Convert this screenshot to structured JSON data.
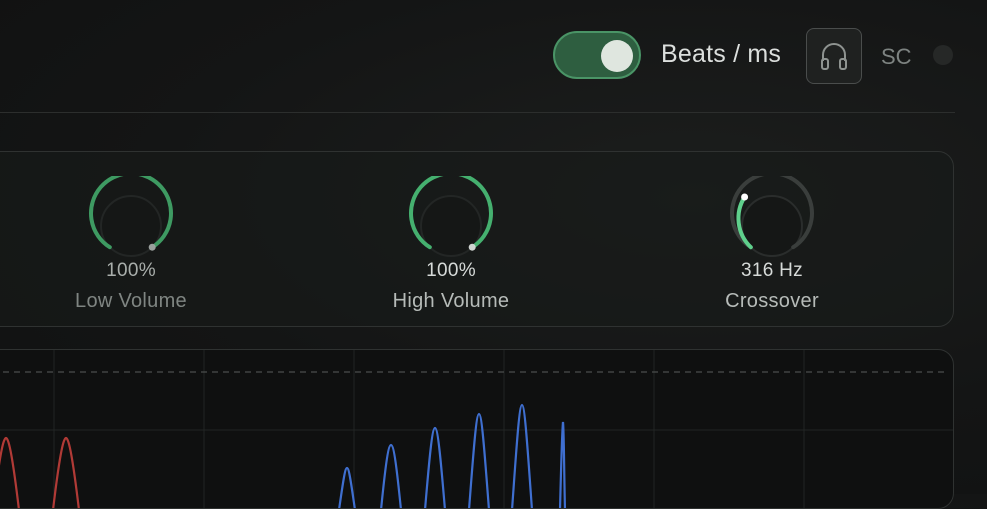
{
  "header": {
    "toggle_state": "on",
    "toggle_label": "Beats / ms",
    "monitor_icon": "headphones-icon",
    "sidechain_label": "SC",
    "sidechain_indicator": "off"
  },
  "knobs": [
    {
      "value": "100%",
      "label": "Low Volume",
      "level": 1.0
    },
    {
      "value": "100%",
      "label": "High Volume",
      "level": 1.0
    },
    {
      "value": "316 Hz",
      "label": "Crossover",
      "level": 0.12
    }
  ],
  "colors": {
    "accent_green": "#3e9a62",
    "accent_green_bright": "#5fd08c",
    "toggle_fill": "#2e5e40",
    "low_band_curve": "#b03a36",
    "high_band_curve": "#3f6fd0"
  }
}
